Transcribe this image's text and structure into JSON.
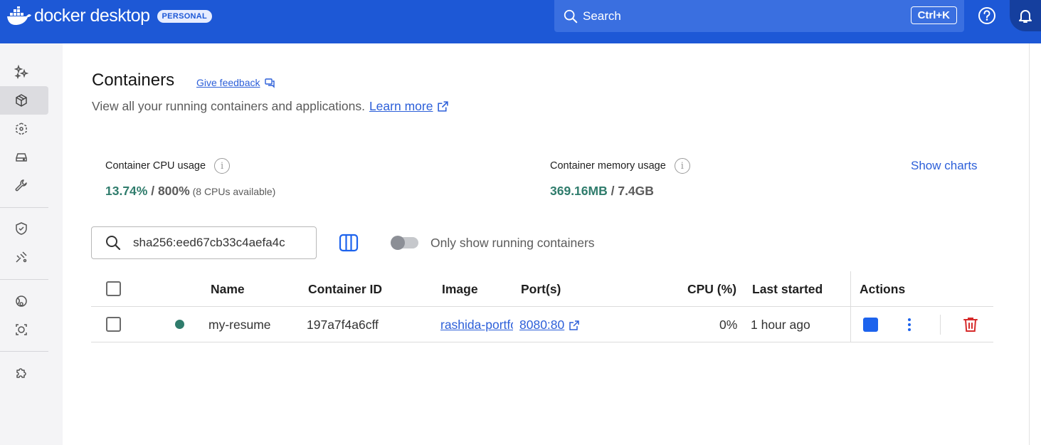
{
  "topbar": {
    "brand": "docker desktop",
    "badge": "PERSONAL",
    "search_label": "Search",
    "search_shortcut": "Ctrl+K",
    "icons": [
      "docker-logo-icon",
      "search-icon",
      "help-icon",
      "bell-icon"
    ]
  },
  "sidebar": {
    "items": [
      {
        "name": "ask-gordon",
        "icon": "sparkle-icon",
        "active": false
      },
      {
        "name": "containers",
        "icon": "cube-icon",
        "active": true
      },
      {
        "name": "images",
        "icon": "image-layers-icon",
        "active": false
      },
      {
        "name": "volumes",
        "icon": "drive-icon",
        "active": false
      },
      {
        "name": "builds",
        "icon": "wrench-icon",
        "active": false
      },
      {
        "name": "docker-scout",
        "icon": "shield-icon",
        "active": false
      },
      {
        "name": "models",
        "icon": "model-icon",
        "active": false
      },
      {
        "name": "docker-hub",
        "icon": "hub-icon",
        "active": false
      },
      {
        "name": "scout-other",
        "icon": "scan-icon",
        "active": false
      },
      {
        "name": "extensions",
        "icon": "puzzle-icon",
        "active": false
      }
    ]
  },
  "page": {
    "title": "Containers",
    "feedback_label": "Give feedback",
    "subtitle": "View all your running containers and applications.",
    "learn_more": "Learn more"
  },
  "stats": {
    "cpu_label": "Container CPU usage",
    "cpu_used": "13.74%",
    "cpu_total": " / 800%",
    "cpu_note": " (8 CPUs available)",
    "mem_label": "Container memory usage",
    "mem_used": "369.16MB",
    "mem_total": " / 7.4GB",
    "show_charts": "Show charts"
  },
  "filter": {
    "search_value": "sha256:eed67cb33c4aefa4c",
    "toggle_label": "Only show running containers",
    "toggle_on": false
  },
  "table": {
    "headers": {
      "name": "Name",
      "container_id": "Container ID",
      "image": "Image",
      "ports": "Port(s)",
      "cpu": "CPU (%)",
      "last_started": "Last started",
      "actions": "Actions"
    },
    "rows": [
      {
        "status": "running",
        "name": "my-resume",
        "container_id": "197a7f4a6cff",
        "image": "rashida-portfolio",
        "ports": "8080:80",
        "cpu": "0%",
        "last_started": "1 hour ago"
      }
    ]
  },
  "colors": {
    "topbar": "#1d58d6",
    "accent": "#2c5fd9",
    "running": "#2f7c6c",
    "delete": "#d62b2b"
  }
}
